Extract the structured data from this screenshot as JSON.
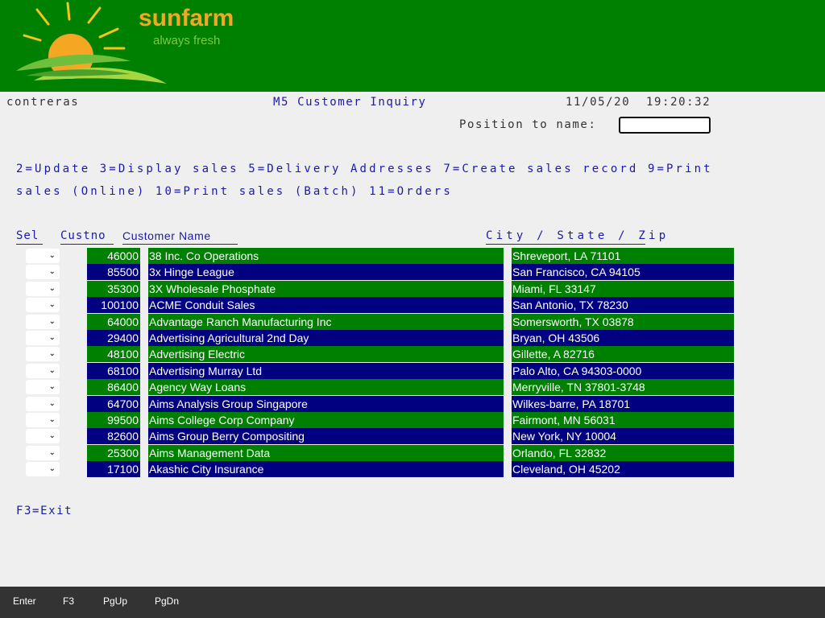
{
  "header": {
    "brand": "sunfarm",
    "tagline": "always fresh",
    "colors": {
      "bar": "#008000",
      "brand": "#f5a623",
      "tagline": "#7dc93f"
    }
  },
  "info": {
    "user": "contreras",
    "title": "M5 Customer Inquiry",
    "date": "11/05/20",
    "time": "19:20:32"
  },
  "position": {
    "label": "Position to name:",
    "value": ""
  },
  "options": {
    "line1": "2=Update 3=Display sales 5=Delivery Addresses 7=Create sales record 9=Print",
    "line2": "sales (Online) 10=Print sales (Batch) 11=Orders"
  },
  "columns": {
    "sel": "Sel",
    "custno": "Custno",
    "name": "Customer Name",
    "city": "City / State / Zip"
  },
  "rows": [
    {
      "custno": "46000",
      "name": "38 Inc. Co Operations",
      "city": "Shreveport, LA 71101"
    },
    {
      "custno": "85500",
      "name": "3x Hinge League",
      "city": "San Francisco, CA 94105"
    },
    {
      "custno": "35300",
      "name": "3X Wholesale Phosphate",
      "city": "Miami, FL 33147"
    },
    {
      "custno": "100100",
      "name": "ACME Conduit Sales",
      "city": "San Antonio, TX 78230"
    },
    {
      "custno": "64000",
      "name": "Advantage Ranch Manufacturing Inc",
      "city": "Somersworth, TX 03878"
    },
    {
      "custno": "29400",
      "name": "Advertising Agricultural 2nd Day",
      "city": "Bryan, OH 43506"
    },
    {
      "custno": "48100",
      "name": "Advertising Electric",
      "city": "Gillette, A 82716"
    },
    {
      "custno": "68100",
      "name": "Advertising Murray Ltd",
      "city": "Palo Alto, CA 94303-0000"
    },
    {
      "custno": "86400",
      "name": "Agency Way Loans",
      "city": "Merryville, TN 37801-3748"
    },
    {
      "custno": "64700",
      "name": "Aims Analysis Group Singapore",
      "city": "Wilkes-barre, PA 18701"
    },
    {
      "custno": "99500",
      "name": "Aims College Corp Company",
      "city": "Fairmont, MN 56031"
    },
    {
      "custno": "82600",
      "name": "Aims Group Berry Compositing",
      "city": "New York, NY 10004"
    },
    {
      "custno": "25300",
      "name": "Aims Management Data",
      "city": "Orlando, FL 32832"
    },
    {
      "custno": "17100",
      "name": "Akashic City Insurance",
      "city": "Cleveland, OH 45202"
    }
  ],
  "row_colors": [
    "#008000",
    "#000080"
  ],
  "f3": "F3=Exit",
  "footer": {
    "keys": [
      "Enter",
      "F3",
      "PgUp",
      "PgDn"
    ]
  }
}
